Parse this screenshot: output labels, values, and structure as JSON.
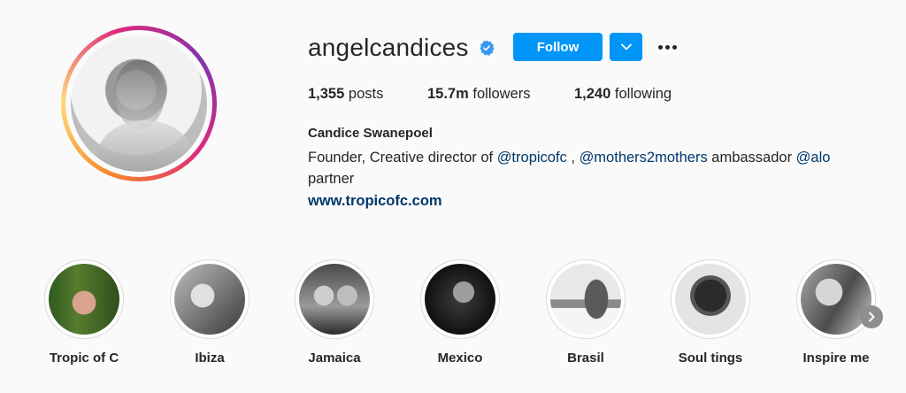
{
  "profile": {
    "username": "angelcandices",
    "verified_icon": "verified-badge-icon",
    "follow_label": "Follow",
    "dropdown_icon": "chevron-down-icon",
    "more_icon": "more-options-icon",
    "posts_count": "1,355",
    "posts_label": "posts",
    "followers_count": "15.7m",
    "followers_label": "followers",
    "following_count": "1,240",
    "following_label": "following",
    "full_name": "Candice Swanepoel",
    "bio": {
      "part1": "Founder, Creative director of ",
      "mention1": "@tropicofc",
      "part2": " , ",
      "mention2": "@mothers2mothers",
      "part3": " ambassador ",
      "mention3": "@alo",
      "part4": " partner"
    },
    "website": "www.tropicofc.com"
  },
  "highlights": [
    {
      "label": "Tropic of C"
    },
    {
      "label": "Ibiza"
    },
    {
      "label": "Jamaica"
    },
    {
      "label": "Mexico"
    },
    {
      "label": "Brasil"
    },
    {
      "label": "Soul tings"
    },
    {
      "label": "Inspire me"
    }
  ],
  "colors": {
    "accent": "#0095f6",
    "link": "#00376b",
    "text": "#262626",
    "background": "#fafafa"
  },
  "icons": {
    "next": "chevron-right-icon"
  }
}
